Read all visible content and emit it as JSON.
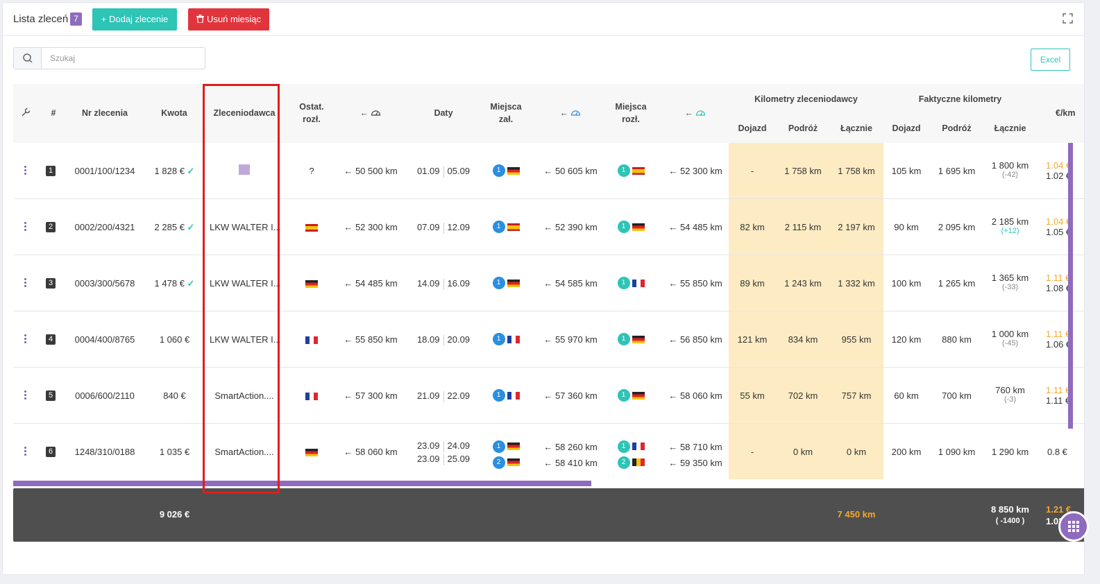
{
  "header": {
    "title": "Lista zleceń",
    "count": "7",
    "add_label": "+ Dodaj zlecenie",
    "delete_label": "Usuń miesiąc"
  },
  "search": {
    "placeholder": "Szukaj"
  },
  "excel_label": "Excel",
  "columns": {
    "hash": "#",
    "nr": "Nr zlecenia",
    "kwota": "Kwota",
    "zleceniodawca": "Zleceniodawca",
    "ostat": "Ostat.",
    "rozl": "rozł.",
    "arrow": "←",
    "daty": "Daty",
    "miejsca": "Miejsca",
    "zal": "zał.",
    "km_zlec": "Kilometry zleceniodawcy",
    "km_fakt": "Faktyczne kilometry",
    "dojazd": "Dojazd",
    "podroz": "Podróż",
    "lacznie": "Łącznie",
    "eur_km": "€/km"
  },
  "rows": [
    {
      "num": "1",
      "nr": "0001/100/1234",
      "kwota": "1 828 €",
      "paid": true,
      "client": "",
      "ostat": "?",
      "odo1": "← 50 500 km",
      "d1": "01.09",
      "d2": "05.09",
      "z_n": "1",
      "odo2": "← 50 605 km",
      "r_n": "1",
      "odo3": "← 52 300 km",
      "kz_d": "-",
      "kz_p": "1 758 km",
      "kz_l": "1 758 km",
      "kf_d": "105 km",
      "kf_p": "1 695 km",
      "kf_l": "1 800 km",
      "kf_diff": "(-42)",
      "e1": "1.04 €",
      "e2": "1.02 €"
    },
    {
      "num": "2",
      "nr": "0002/200/4321",
      "kwota": "2 285 €",
      "paid": true,
      "client": "LKW WALTER I...",
      "ostat": "",
      "odo1": "← 52 300 km",
      "d1": "07.09",
      "d2": "12.09",
      "z_n": "1",
      "odo2": "← 52 390 km",
      "r_n": "1",
      "odo3": "← 54 485 km",
      "kz_d": "82 km",
      "kz_p": "2 115 km",
      "kz_l": "2 197 km",
      "kf_d": "90 km",
      "kf_p": "2 095 km",
      "kf_l": "2 185 km",
      "kf_diff": "(+12)",
      "e1": "1.04 €",
      "e2": "1.05 €"
    },
    {
      "num": "3",
      "nr": "0003/300/5678",
      "kwota": "1 478 €",
      "paid": true,
      "client": "LKW WALTER I...",
      "ostat": "",
      "odo1": "← 54 485 km",
      "d1": "14.09",
      "d2": "16.09",
      "z_n": "1",
      "odo2": "← 54 585 km",
      "r_n": "1",
      "odo3": "← 55 850 km",
      "kz_d": "89 km",
      "kz_p": "1 243 km",
      "kz_l": "1 332 km",
      "kf_d": "100 km",
      "kf_p": "1 265 km",
      "kf_l": "1 365 km",
      "kf_diff": "(-33)",
      "e1": "1.11 €",
      "e2": "1.08 €"
    },
    {
      "num": "4",
      "nr": "0004/400/8765",
      "kwota": "1 060 €",
      "paid": false,
      "client": "LKW WALTER I...",
      "ostat": "",
      "odo1": "← 55 850 km",
      "d1": "18.09",
      "d2": "20.09",
      "z_n": "1",
      "odo2": "← 55 970 km",
      "r_n": "1",
      "odo3": "← 56 850 km",
      "kz_d": "121 km",
      "kz_p": "834 km",
      "kz_l": "955 km",
      "kf_d": "120 km",
      "kf_p": "880 km",
      "kf_l": "1 000 km",
      "kf_diff": "(-45)",
      "e1": "1.11 €",
      "e2": "1.06 €"
    },
    {
      "num": "5",
      "nr": "0006/600/2110",
      "kwota": "840 €",
      "paid": false,
      "client": "SmartAction....",
      "ostat": "",
      "odo1": "← 57 300 km",
      "d1": "21.09",
      "d2": "22.09",
      "z_n": "1",
      "odo2": "← 57 360 km",
      "r_n": "1",
      "odo3": "← 58 060 km",
      "kz_d": "55 km",
      "kz_p": "702 km",
      "kz_l": "757 km",
      "kf_d": "60 km",
      "kf_p": "700 km",
      "kf_l": "760 km",
      "kf_diff": "(-3)",
      "e1": "1.11 €",
      "e2": "1.11 €"
    },
    {
      "num": "6",
      "nr": "1248/310/0188",
      "kwota": "1 035 €",
      "paid": false,
      "client": "SmartAction....",
      "ostat": "",
      "odo1": "← 58 060 km",
      "d1": "23.09",
      "d2": "24.09",
      "d3": "23.09",
      "d4": "25.09",
      "z_n": "1",
      "z_n2": "2",
      "odo2": "← 58 260 km",
      "odo2b": "← 58 410 km",
      "r_n": "1",
      "r_n2": "2",
      "odo3": "← 58 710 km",
      "odo3b": "← 59 350 km",
      "kz_d": "-",
      "kz_p": "0 km",
      "kz_l": "0 km",
      "kf_d": "200 km",
      "kf_p": "1 090 km",
      "kf_l": "1 290 km",
      "kf_diff": "",
      "e1": "",
      "e2": "0.8 €"
    }
  ],
  "footer": {
    "kwota": "9 026 €",
    "kz_total": "7 450 km",
    "kf_total": "8 850 km",
    "kf_diff": "( -1400 )",
    "e1": "1.21 €",
    "e2": "1.02"
  },
  "colors": {
    "accent": "#8e6bbf",
    "teal": "#2ec4b6",
    "red": "#e1353e",
    "highlight": "#fdebc3"
  }
}
